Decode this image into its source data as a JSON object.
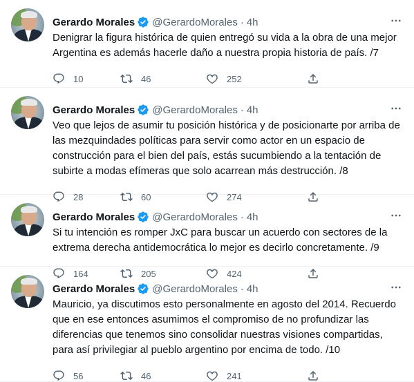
{
  "tweets": [
    {
      "name": "Gerardo Morales",
      "handle": "@GerardoMorales",
      "separator": "·",
      "time": "4h",
      "lines": [
        "Denigrar la figura histórica de quien entregó su vida a la obra de una mejor",
        "Argentina es además hacerle daño a nuestra propia historia de país. /7"
      ],
      "replies": "10",
      "retweets": "46",
      "likes": "252"
    },
    {
      "name": "Gerardo Morales",
      "handle": "@GerardoMorales",
      "separator": "·",
      "time": "4h",
      "lines": [
        "Veo que lejos de asumir tu posición histórica y de posicionarte por arriba de",
        "las mezquindades políticas para servir como actor en un espacio de",
        "construcción para el bien del país, estás sucumbiendo a la tentación de",
        "subirte a modas efímeras que solo acarrean más destrucción. /8"
      ],
      "replies": "28",
      "retweets": "60",
      "likes": "274"
    },
    {
      "name": "Gerardo Morales",
      "handle": "@GerardoMorales",
      "separator": "·",
      "time": "4h",
      "lines": [
        "Si tu intención es romper JxC para buscar un acuerdo con sectores de la",
        "extrema derecha antidemocrática lo mejor es decirlo concretamente. /9"
      ],
      "replies": "164",
      "retweets": "205",
      "likes": "424"
    },
    {
      "name": "Gerardo Morales",
      "handle": "@GerardoMorales",
      "separator": "·",
      "time": "4h",
      "lines": [
        "Mauricio, ya discutimos esto personalmente en agosto del 2014. Recuerdo",
        "que en ese entonces asumimos el compromiso de no profundizar las",
        "diferencias que tenemos sino consolidar nuestras visiones compartidas,",
        "para así privilegiar al pueblo argentino por encima de todo. /10"
      ],
      "replies": "56",
      "retweets": "46",
      "likes": "241"
    }
  ],
  "icons": {
    "verified": "verified-badge-icon",
    "more": "more-options-icon",
    "reply": "reply-icon",
    "retweet": "retweet-icon",
    "like": "like-icon",
    "share": "share-icon"
  },
  "colors": {
    "text": "#0f1419",
    "secondary": "#536471",
    "verified": "#1d9bf0",
    "divider": "#eff3f4"
  }
}
